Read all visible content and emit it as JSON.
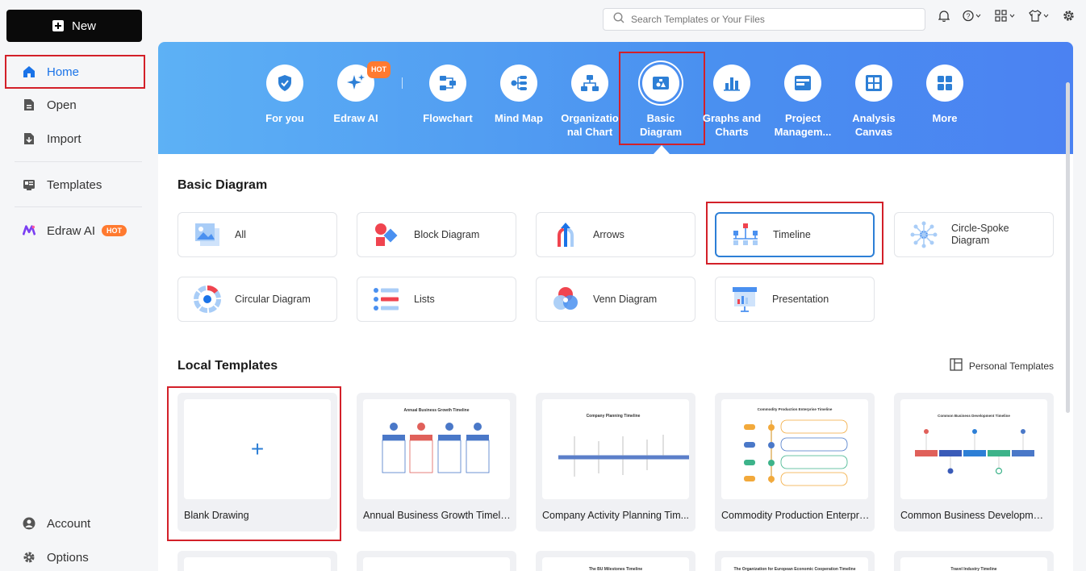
{
  "sidebar": {
    "new_label": "New",
    "items": [
      {
        "label": "Home"
      },
      {
        "label": "Open"
      },
      {
        "label": "Import"
      },
      {
        "label": "Templates"
      },
      {
        "label": "Edraw AI",
        "badge": "HOT"
      }
    ],
    "bottom": [
      {
        "label": "Account"
      },
      {
        "label": "Options"
      }
    ]
  },
  "search": {
    "placeholder": "Search Templates or Your Files"
  },
  "banner": {
    "categories": [
      {
        "label": "For you"
      },
      {
        "label": "Edraw AI",
        "badge": "HOT"
      },
      {
        "label": "Flowchart"
      },
      {
        "label": "Mind Map"
      },
      {
        "label": "Organizatio nal Chart"
      },
      {
        "label": "Basic Diagram"
      },
      {
        "label": "Graphs and Charts"
      },
      {
        "label": "Project Managem..."
      },
      {
        "label": "Analysis Canvas"
      },
      {
        "label": "More"
      }
    ]
  },
  "basic": {
    "title": "Basic Diagram",
    "tiles": [
      {
        "label": "All"
      },
      {
        "label": "Block Diagram"
      },
      {
        "label": "Arrows"
      },
      {
        "label": "Timeline"
      },
      {
        "label": "Circle-Spoke Diagram"
      },
      {
        "label": "Circular Diagram"
      },
      {
        "label": "Lists"
      },
      {
        "label": "Venn Diagram"
      },
      {
        "label": "Presentation"
      }
    ]
  },
  "local": {
    "title": "Local Templates",
    "personal_label": "Personal Templates",
    "cards": [
      {
        "name": "Blank Drawing"
      },
      {
        "name": "Annual Business Growth Timeline",
        "thumb_title": "Annual Business Growth Timeline"
      },
      {
        "name": "Company Activity Planning Tim...",
        "thumb_title": "Company Planning Timeline"
      },
      {
        "name": "Commodity Production Enterpri...",
        "thumb_title": "Commodity Production Enterprise Timeline"
      },
      {
        "name": "Common Business Developmen...",
        "thumb_title": "Common Business Development Timeline"
      }
    ],
    "row2_titles": [
      "",
      "",
      "The BU Milestones Timeline",
      "The Organization for European Economic Cooperation Timeline",
      "Travel Industry Timeline"
    ]
  },
  "colors": {
    "accent": "#1a73e8",
    "highlight": "#d32029",
    "banner": "#4a90f0"
  }
}
